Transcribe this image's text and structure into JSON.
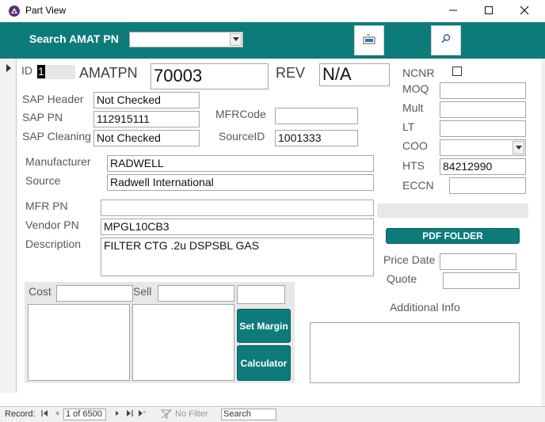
{
  "window": {
    "title": "Part View",
    "minimize_icon": "minimize-icon",
    "maximize_icon": "maximize-icon",
    "close_icon": "close-icon"
  },
  "header": {
    "search_label": "Search AMAT PN",
    "search_value": "",
    "new_icon": "new-record-icon",
    "search_icon": "search-icon",
    "color": "#0e7b7b"
  },
  "record": {
    "id_label": "ID",
    "id_value": "1",
    "amatpn_label": "AMATPN",
    "amatpn_value": "70003",
    "rev_label": "REV",
    "rev_value": "N/A",
    "sap_header_label": "SAP Header",
    "sap_header_value": "Not Checked",
    "sap_pn_label": "SAP PN",
    "sap_pn_value": "112915111",
    "sap_cleaning_label": "SAP Cleaning",
    "sap_cleaning_value": "Not Checked",
    "mfrcode_label": "MFRCode",
    "mfrcode_value": "",
    "sourceid_label": "SourceID",
    "sourceid_value": "1001333",
    "manufacturer_label": "Manufacturer",
    "manufacturer_value": "RADWELL",
    "source_label": "Source",
    "source_value": "Radwell International",
    "mfr_pn_label": "MFR PN",
    "mfr_pn_value": "",
    "vendor_pn_label": "Vendor PN",
    "vendor_pn_value": "MPGL10CB3",
    "description_label": "Description",
    "description_value": "FILTER CTG .2u DSPSBL GAS"
  },
  "right": {
    "ncnr_label": "NCNR",
    "ncnr_checked": false,
    "moq_label": "MOQ",
    "moq_value": "",
    "mult_label": "Mult",
    "mult_value": "",
    "lt_label": "LT",
    "lt_value": "",
    "coo_label": "COO",
    "coo_value": "",
    "hts_label": "HTS",
    "hts_value": "84212990",
    "eccn_label": "ECCN",
    "eccn_value": "",
    "pdf_folder_label": "PDF FOLDER",
    "price_date_label": "Price Date",
    "price_date_value": "",
    "quote_label": "Quote",
    "quote_value": "",
    "additional_info_label": "Additional Info",
    "additional_info_value": ""
  },
  "pricing": {
    "cost_label": "Cost",
    "cost_value": "",
    "sell_label": "Sell",
    "sell_value": "",
    "margin_value": "",
    "set_margin_label": "Set Margin",
    "calculator_label": "Calculator"
  },
  "statusbar": {
    "record_label": "Record:",
    "record_position": "1 of 6500",
    "filter_label": "No Filter",
    "search_placeholder": "Search"
  }
}
